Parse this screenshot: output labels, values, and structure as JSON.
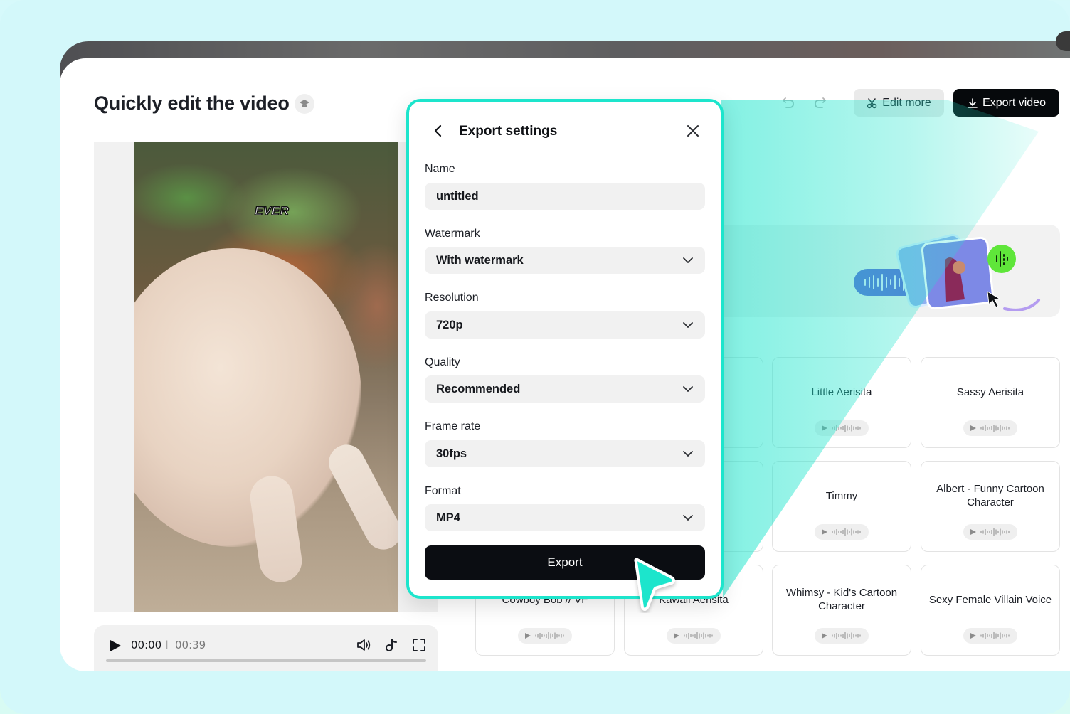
{
  "header": {
    "title": "Quickly edit the video",
    "title_badge_icon": "graduation-cap-icon",
    "undo_icon": "undo-icon",
    "redo_icon": "redo-icon",
    "edit_more_label": "Edit more",
    "edit_more_icon": "scissors-icon",
    "export_video_label": "Export video",
    "export_video_icon": "download-icon"
  },
  "video": {
    "caption": "EVER",
    "current_time": "00:00",
    "separator": "|",
    "total_time": "00:39",
    "progress": 0,
    "icons": [
      "play-icon",
      "volume-icon",
      "tiktok-icon",
      "fullscreen-icon"
    ]
  },
  "modal": {
    "title": "Export settings",
    "fields": [
      {
        "label": "Name",
        "value": "untitled",
        "type": "input"
      },
      {
        "label": "Watermark",
        "value": "With watermark",
        "type": "select"
      },
      {
        "label": "Resolution",
        "value": "720p",
        "type": "select"
      },
      {
        "label": "Quality",
        "value": "Recommended",
        "type": "select"
      },
      {
        "label": "Frame rate",
        "value": "30fps",
        "type": "select"
      },
      {
        "label": "Format",
        "value": "MP4",
        "type": "select"
      }
    ],
    "export_label": "Export"
  },
  "voices": [
    {
      "name": ""
    },
    {
      "name": ""
    },
    {
      "name": "Little Aerisita"
    },
    {
      "name": "Sassy Aerisita"
    },
    {
      "name": ""
    },
    {
      "name": ""
    },
    {
      "name": "Timmy"
    },
    {
      "name": "Albert - Funny Cartoon Character"
    },
    {
      "name": "Cowboy Bob // VF"
    },
    {
      "name": "Kawaii Aerisita"
    },
    {
      "name": "Whimsy - Kid's Cartoon Character"
    },
    {
      "name": "Sexy Female Villain Voice"
    }
  ],
  "colors": {
    "accent_teal": "#1de5cc",
    "dark_button": "#06090c",
    "voice_pill": "#5e63d8",
    "mic_badge": "#5fe63a"
  }
}
